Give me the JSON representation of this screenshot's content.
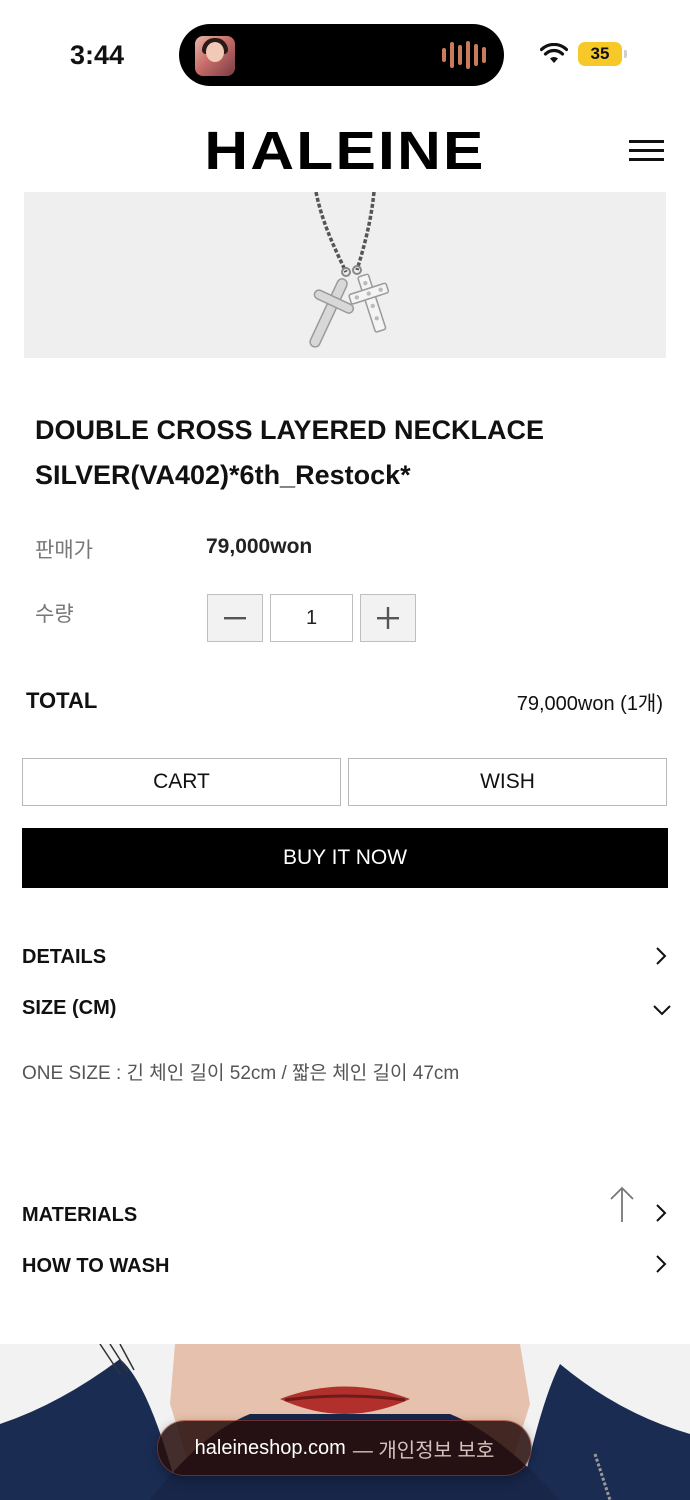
{
  "status_bar": {
    "time": "3:44",
    "battery": "35",
    "battery_color": "#f6c928"
  },
  "header": {
    "logo": "HALEINE",
    "menu_icon": "hamburger-menu-icon"
  },
  "product": {
    "image_icon": "double-cross-necklace-image",
    "title_line1": "DOUBLE CROSS LAYERED NECKLACE",
    "title_line2": "SILVER(VA402)*6th_Restock*",
    "price_label": "판매가",
    "price_value": "79,000won",
    "quantity_label": "수량",
    "quantity_value": "1"
  },
  "total": {
    "label": "TOTAL",
    "value": "79,000won (1개)"
  },
  "actions": {
    "cart": "CART",
    "wish": "WISH",
    "buy_now": "BUY IT NOW",
    "buy_color": "#000000"
  },
  "accordion": [
    {
      "label": "DETAILS",
      "state": "collapsed"
    },
    {
      "label": "SIZE (CM)",
      "state": "expanded",
      "content": "ONE SIZE : 긴 체인 길이 52cm / 짧은 체인 길이 47cm"
    },
    {
      "label": "MATERIALS",
      "state": "collapsed"
    },
    {
      "label": "HOW TO WASH",
      "state": "collapsed"
    }
  ],
  "browser": {
    "domain": "haleineshop.com",
    "note": "— 개인정보 보호"
  }
}
